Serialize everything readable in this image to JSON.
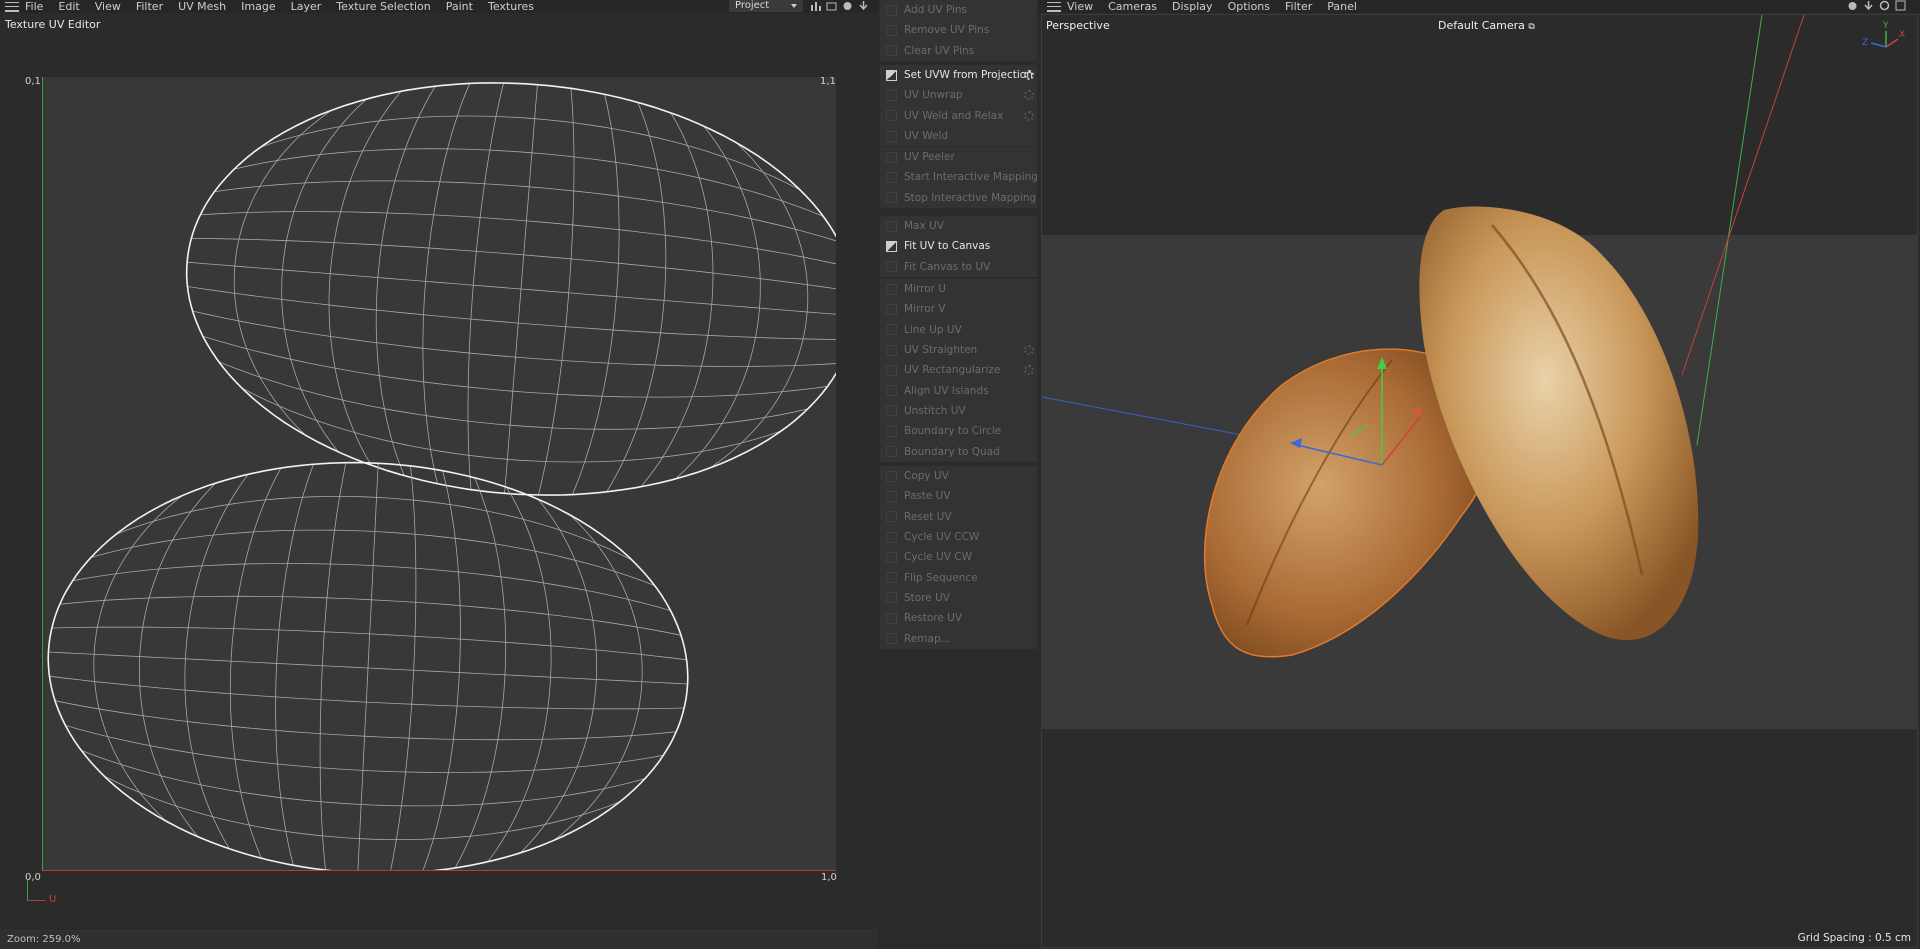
{
  "uv_editor": {
    "menu": [
      "File",
      "Edit",
      "View",
      "Filter",
      "UV Mesh",
      "Image",
      "Layer",
      "Texture Selection",
      "Paint",
      "Textures"
    ],
    "title": "Texture UV Editor",
    "project_select": "Project",
    "corners": {
      "top_left": "0,1",
      "top_right": "1,1",
      "bottom_left": "0,0",
      "bottom_right": "1,0"
    },
    "axis_u": "U",
    "zoom": "Zoom: 259.0%"
  },
  "commands": {
    "groups": [
      {
        "items": [
          {
            "label": "Add UV Pins",
            "enabled": false,
            "gear": false
          },
          {
            "label": "Remove UV Pins",
            "enabled": false,
            "gear": false
          },
          {
            "label": "Clear UV Pins",
            "enabled": false,
            "gear": false
          }
        ]
      },
      {
        "items": [
          {
            "label": "Set UVW from Projection",
            "enabled": true,
            "gear": true
          },
          {
            "label": "UV Unwrap",
            "enabled": false,
            "gear": true
          },
          {
            "label": "UV Weld and Relax",
            "enabled": false,
            "gear": true
          },
          {
            "label": "UV Weld",
            "enabled": false,
            "gear": false
          }
        ]
      },
      {
        "items": [
          {
            "label": "UV Peeler",
            "enabled": false,
            "gear": false
          },
          {
            "label": "Start Interactive Mapping",
            "enabled": false,
            "gear": false
          },
          {
            "label": "Stop Interactive Mapping",
            "enabled": false,
            "gear": false
          }
        ]
      },
      {
        "items": [
          {
            "label": "Max UV",
            "enabled": false,
            "gear": false
          },
          {
            "label": "Fit UV to Canvas",
            "enabled": true,
            "gear": false
          },
          {
            "label": "Fit Canvas to UV",
            "enabled": false,
            "gear": false
          }
        ]
      },
      {
        "items": [
          {
            "label": "Mirror U",
            "enabled": false,
            "gear": false
          },
          {
            "label": "Mirror V",
            "enabled": false,
            "gear": false
          },
          {
            "label": "Line Up UV",
            "enabled": false,
            "gear": false
          },
          {
            "label": "UV Straighten",
            "enabled": false,
            "gear": true
          },
          {
            "label": "UV Rectangularize",
            "enabled": false,
            "gear": true
          },
          {
            "label": "Align UV Islands",
            "enabled": false,
            "gear": false
          },
          {
            "label": "Unstitch UV",
            "enabled": false,
            "gear": false
          },
          {
            "label": "Boundary to Circle",
            "enabled": false,
            "gear": false
          },
          {
            "label": "Boundary to Quad",
            "enabled": false,
            "gear": false
          }
        ]
      },
      {
        "items": [
          {
            "label": "Copy UV",
            "enabled": false,
            "gear": false
          },
          {
            "label": "Paste UV",
            "enabled": false,
            "gear": false
          },
          {
            "label": "Reset UV",
            "enabled": false,
            "gear": false
          },
          {
            "label": "Cycle UV CCW",
            "enabled": false,
            "gear": false
          },
          {
            "label": "Cycle UV CW",
            "enabled": false,
            "gear": false
          },
          {
            "label": "Flip Sequence",
            "enabled": false,
            "gear": false
          },
          {
            "label": "Store UV",
            "enabled": false,
            "gear": false
          },
          {
            "label": "Restore UV",
            "enabled": false,
            "gear": false
          },
          {
            "label": "Remap...",
            "enabled": false,
            "gear": false
          }
        ]
      }
    ]
  },
  "viewport": {
    "menu": [
      "View",
      "Cameras",
      "Display",
      "Options",
      "Filter",
      "Panel"
    ],
    "label": "Perspective",
    "camera": "Default Camera",
    "grid_spacing": "Grid Spacing : 0.5 cm",
    "axis_labels": {
      "x": "X",
      "y": "Y",
      "z": "Z"
    }
  },
  "colors": {
    "accent_orange": "#e07a2e",
    "axis_x": "#d04040",
    "axis_y": "#40b040",
    "axis_z": "#3a6ad8"
  }
}
